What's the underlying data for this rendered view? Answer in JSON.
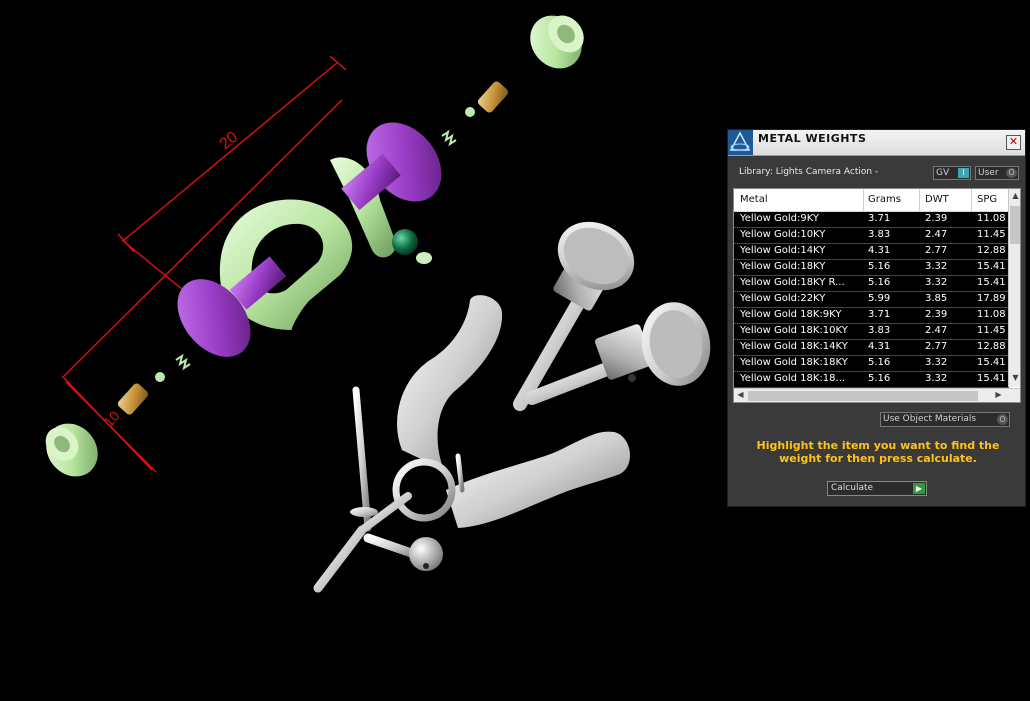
{
  "viewport": {
    "dimension_top": "20",
    "dimension_side": "10",
    "colors": {
      "green": "#c8f0b4",
      "purple": "#9b3ec8",
      "bronze": "#c8963c",
      "silver": "#cfcfcf",
      "dim_line": "#e01010"
    }
  },
  "panel": {
    "title": "METAL WEIGHTS",
    "close_icon": "close-icon",
    "library_label": "Library: Lights Camera Action -",
    "toggle_gv": "GV",
    "toggle_user": "User",
    "columns": [
      "Metal",
      "Grams",
      "DWT",
      "SPG"
    ],
    "rows": [
      [
        "Yellow Gold:9KY",
        "3.71",
        "2.39",
        "11.08"
      ],
      [
        "Yellow Gold:10KY",
        "3.83",
        "2.47",
        "11.45"
      ],
      [
        "Yellow Gold:14KY",
        "4.31",
        "2.77",
        "12.88"
      ],
      [
        "Yellow Gold:18KY",
        "5.16",
        "3.32",
        "15.41"
      ],
      [
        "Yellow Gold:18KY R...",
        "5.16",
        "3.32",
        "15.41"
      ],
      [
        "Yellow Gold:22KY",
        "5.99",
        "3.85",
        "17.89"
      ],
      [
        "Yellow Gold 18K:9KY",
        "3.71",
        "2.39",
        "11.08"
      ],
      [
        "Yellow Gold 18K:10KY",
        "3.83",
        "2.47",
        "11.45"
      ],
      [
        "Yellow Gold 18K:14KY",
        "4.31",
        "2.77",
        "12.88"
      ],
      [
        "Yellow Gold 18K:18KY",
        "5.16",
        "3.32",
        "15.41"
      ],
      [
        "Yellow Gold 18K:18...",
        "5.16",
        "3.32",
        "15.41"
      ]
    ],
    "use_object_materials": "Use Object Materials",
    "hint": "Highlight the item you want to find the weight for then press calculate.",
    "calculate_label": "Calculate"
  }
}
